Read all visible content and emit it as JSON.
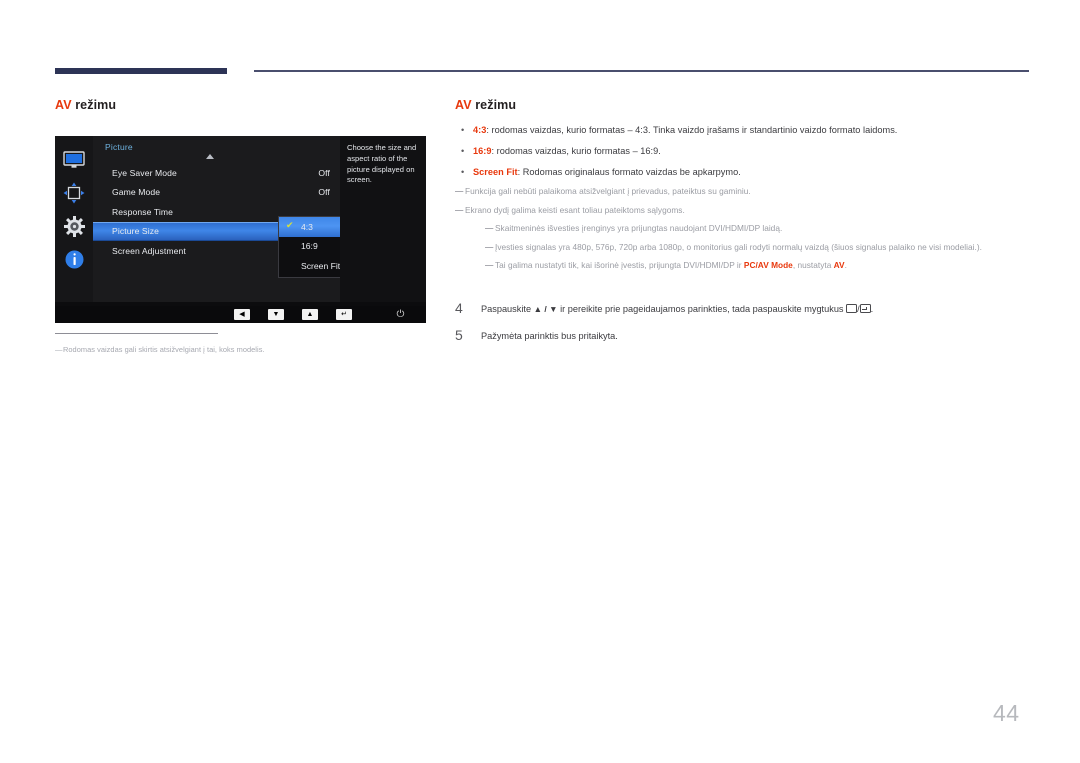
{
  "page": {
    "number": "44"
  },
  "left": {
    "title_accent": "AV",
    "title_rest": " režimu",
    "footnote": "Rodomas vaizdas gali skirtis atsižvelgiant į tai, koks modelis.",
    "footnote_dash": "―"
  },
  "osd": {
    "sidebar_icons": [
      "monitor-icon",
      "screen-adjust-icon",
      "gear-icon",
      "info-icon"
    ],
    "menu_title": "Picture",
    "rows": [
      {
        "label": "Eye Saver Mode",
        "value": "Off",
        "selected": false
      },
      {
        "label": "Game Mode",
        "value": "Off",
        "selected": false
      },
      {
        "label": "Response Time",
        "value": "",
        "selected": false
      },
      {
        "label": "Picture Size",
        "value": "",
        "selected": true
      },
      {
        "label": "Screen Adjustment",
        "value": "",
        "selected": false
      }
    ],
    "submenu": [
      {
        "label": "4:3",
        "checked": true,
        "selected": true
      },
      {
        "label": "16:9",
        "checked": false,
        "selected": false
      },
      {
        "label": "Screen Fit",
        "checked": false,
        "selected": false
      }
    ],
    "checkmark": "✔",
    "description": "Choose the size and aspect ratio of the picture displayed on screen.",
    "buttons": [
      {
        "name": "osd-button-left",
        "glyph": "◀"
      },
      {
        "name": "osd-button-down",
        "glyph": "▼"
      },
      {
        "name": "osd-button-up",
        "glyph": "▲"
      },
      {
        "name": "osd-button-enter",
        "glyph": "↵"
      }
    ],
    "power_glyph": "⏻"
  },
  "right": {
    "title_accent": "AV",
    "title_rest": " režimu",
    "bullet_dot": "•",
    "bullets": [
      {
        "bold": "4:3",
        "rest": ": rodomas vaizdas, kurio formatas – 4:3. Tinka vaizdo įrašams ir standartinio vaizdo formato laidoms."
      },
      {
        "bold": "16:9",
        "rest": ": rodomas vaizdas, kurio formatas – 16:9."
      },
      {
        "bold": "Screen Fit",
        "rest": ": Rodomas originalaus formato vaizdas be apkarpymo."
      }
    ],
    "note_dash": "―",
    "notes": [
      {
        "indent": false,
        "text": "Funkcija gali nebūti palaikoma atsižvelgiant į prievadus, pateiktus su gaminiu."
      },
      {
        "indent": false,
        "text": "Ekrano dydį galima keisti esant toliau pateiktoms sąlygoms."
      },
      {
        "indent": true,
        "text": "Skaitmeninės išvesties įrenginys yra prijungtas naudojant DVI/HDMI/DP laidą."
      },
      {
        "indent": true,
        "text": "Įvesties signalas yra 480p, 576p, 720p arba 1080p, o monitorius gali rodyti normalų vaizdą (šiuos signalus palaiko ne visi modeliai.)."
      },
      {
        "indent": true,
        "text_pre": "Tai galima nustatyti tik, kai išorinė įvestis, prijungta DVI/HDMI/DP ir ",
        "bold1": "PC/AV Mode",
        "text_mid": ", nustatyta ",
        "bold2": "AV",
        "text_post": "."
      }
    ],
    "steps": [
      {
        "num": "4",
        "pre": "Paspauskite ",
        "arrows": "▲ / ▼",
        "mid": " ir pereikite prie pageidaujamos parinkties, tada paspauskite mygtukus ",
        "post": "."
      },
      {
        "num": "5",
        "text": "Pažymėta parinktis bus pritaikyta."
      }
    ]
  }
}
